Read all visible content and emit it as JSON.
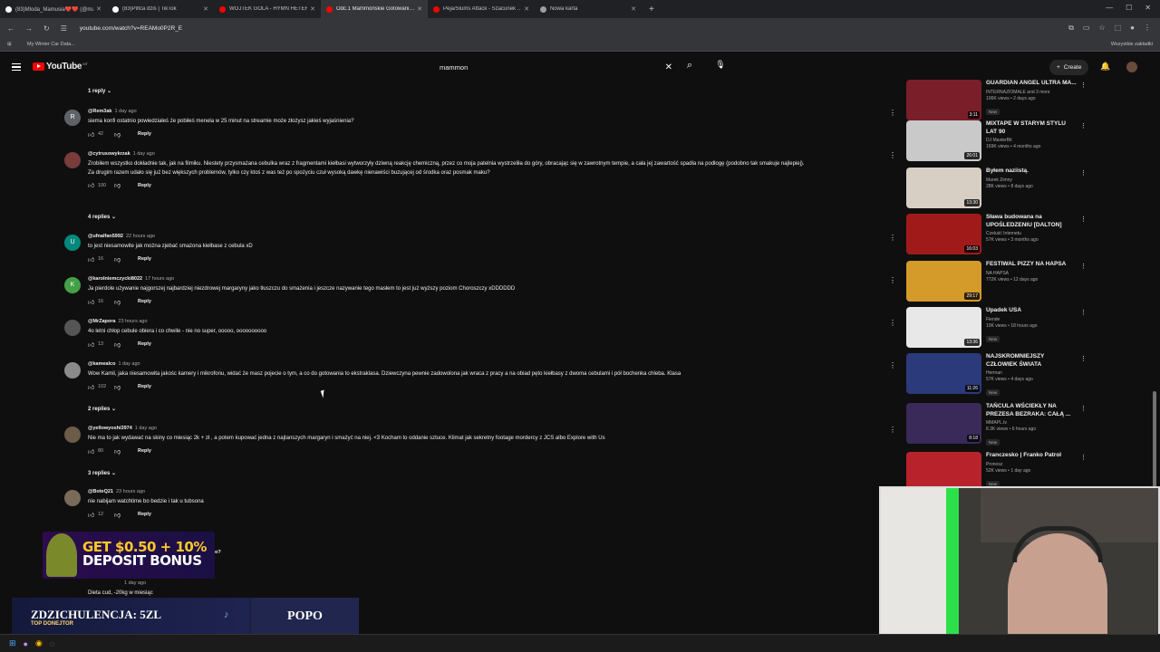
{
  "browser": {
    "tabs": [
      {
        "label": "(83)Mloda_Mamusia❤️❤️ (@ma…",
        "icon": "tiktok-icon",
        "color": "#ffffff"
      },
      {
        "label": "(83)Piltca dziś | TikTok",
        "icon": "tiktok-icon",
        "color": "#ffffff"
      },
      {
        "label": "WOJTEK GOLA - HYMN HETER…",
        "icon": "youtube-icon",
        "color": "#ff0000"
      },
      {
        "label": "Odc.1 Mammońskie Gotowani…",
        "icon": "youtube-icon",
        "color": "#ff0000"
      },
      {
        "label": "Peja/Slums Attack - Szacunek …",
        "icon": "youtube-icon",
        "color": "#ff0000"
      },
      {
        "label": "Nowa karta",
        "icon": "globe-icon",
        "color": "#9aa0a6"
      }
    ],
    "url": "youtube.com/watch?v=REAMo0P2R_E",
    "bookmark": "My Winter Car Data...",
    "bookmarks_all": "Wszystkie zakładki"
  },
  "youtube": {
    "logo": "YouTube",
    "logo_country": "MT",
    "search_value": "mammon",
    "create_label": "Create"
  },
  "comments": [
    {
      "replies_label": "1 reply"
    },
    {
      "author": "@Rem3ak",
      "time": "1 day ago",
      "text": "siema konfi ostatnio powiedziałeś że pobiłeś menela w 25 minut na streamie może złożysz jakieś wyjaśnienia?",
      "likes": "42",
      "reply": "Reply",
      "avatar_letter": "R",
      "avatar_color": "#5f6368"
    },
    {
      "author": "@cytrusowykrzak",
      "time": "1 day ago",
      "text": "Zrobiłem wszystko dokładnie tak, jak na filmiku. Niestety przysmażana cebulka wraz z fragmentami kiełbasi wytworzyły dziwną reakcję chemiczną, przez co moja patelnia wystrzeliła do góry, obracając się w zawrotnym tempie, a cała jej zawartość spadła na podłogę (podobno tak smakuje najlepiej).",
      "text2": "Za drugim razem udało się już bez większych problemów, tylko czy ktoś z was też po spożyciu czuł wysoką dawkę nienawiści buzującej od środka oraz posmak maku?",
      "likes": "100",
      "reply": "Reply",
      "avatar_letter": "",
      "avatar_color": "#7a3b3b"
    },
    {
      "replies_label": "4 replies"
    },
    {
      "author": "@ufnalfan5992",
      "time": "22 hours ago",
      "text": "to jest niesamowite jak można zjebać smażona kiełbase z cebula xD",
      "likes": "16",
      "reply": "Reply",
      "avatar_letter": "U",
      "avatar_color": "#00897b"
    },
    {
      "author": "@karolniemczycki8022",
      "time": "17 hours ago",
      "text": "Ja pierdole używanie najgorszej najbardziej niezdrowej margaryny jako tłuszczu do smażenia i jeszcze nazywanie tego masłem to jest już wyższy poziom Choroszczy xDDDDDD",
      "likes": "16",
      "reply": "Reply",
      "avatar_letter": "K",
      "avatar_color": "#43a047"
    },
    {
      "author": "@MrZapora",
      "time": "23 hours ago",
      "text": "4o letni chłop cebule obiera i co chwile - nie no super, ooooo, oooooooooo",
      "likes": "13",
      "reply": "Reply",
      "avatar_letter": "",
      "avatar_color": "#555555"
    },
    {
      "author": "@kamealco",
      "time": "1 day ago",
      "text": "Wow Kamil, jaka niesamowita jakośc kamery i mikrofonu, widać że masz pojecie o tym, a co do gotowania to ekstraklasa. Dziewczyna pewnie zadowolona jak wraca z pracy a na obiad pęto kiełbasy z dwoma cebulami i pół bochenka chleba. Klasa",
      "likes": "102",
      "reply": "Reply",
      "avatar_letter": "",
      "avatar_color": "#8a8a8a"
    },
    {
      "replies_label": "2 replies"
    },
    {
      "author": "@yellowyoshi3974",
      "time": "1 day ago",
      "text": "Nie ma to jak wydawać na skiny co miesiąc 2k + zł , a potem kupować jedna z najtanszych margaryn i smażyć na niej. <3 Kocham to oddanie sztuce. Klimat jak sekretny footage mordercy z JCS albo Explore with Us",
      "likes": "80",
      "reply": "Reply",
      "avatar_letter": "",
      "avatar_color": "#6d5c4a"
    },
    {
      "replies_label": "3 replies"
    },
    {
      "author": "@BoteQ21",
      "time": "23 hours ago",
      "text": "nie nabijam watchtime bo bedzie i tak u tubsona",
      "likes": "12",
      "reply": "Reply",
      "avatar_letter": "",
      "avatar_color": "#7a6a5a"
    },
    {
      "author_partial": "o?",
      "text": "Dieta cud, -20kg w miesiąc",
      "time": "1 day ago"
    }
  ],
  "sidebar": [
    {
      "title": "GUARDIAN ANGEL ULTRA MA...",
      "channel": "INTERNAZIOMALE",
      "meta": "106K views • 2 days ago",
      "extra": "and 3 more",
      "badge": "New",
      "duration": "3:11",
      "thumb": "#7a1e2a"
    },
    {
      "title": "MIXTAPE W STARYM STYLU LAT 90",
      "channel": "DJ MasterBit",
      "meta": "169K views • 4 months ago",
      "badge": "",
      "duration": "26:01",
      "thumb": "#c9c9c9"
    },
    {
      "title": "Byłem naziistą.",
      "channel": "Marek Zimny",
      "meta": "28K views • 8 days ago",
      "badge": "",
      "duration": "13:30",
      "thumb": "#d8cfc4"
    },
    {
      "title": "Sława budowana na UPOŚLEDZENIU [DALTON]",
      "channel": "Czeluść Internetu",
      "meta": "57K views • 3 months ago",
      "badge": "",
      "duration": "16:03",
      "thumb": "#a11a1a"
    },
    {
      "title": "FESTIWAL PIZZY NA HAPSA",
      "channel": "NA HAPSA",
      "meta": "772K views • 12 days ago",
      "badge": "",
      "duration": "29:17",
      "thumb": "#d49a2a"
    },
    {
      "title": "Upadek USA",
      "channel": "Fiende",
      "meta": "10K views • 18 hours ago",
      "badge": "New",
      "duration": "13:36",
      "thumb": "#e8e8e8"
    },
    {
      "title": "NAJSKROMNIEJSZY CZŁOWIEK ŚWIATA",
      "channel": "Herman",
      "meta": "57K views • 4 days ago",
      "badge": "New",
      "duration": "11:26",
      "thumb": "#2a3a7a"
    },
    {
      "title": "TAŃCULA WŚCIEKŁY NA PREZESA BEZRAKA: CAŁĄ ...",
      "channel": "MMAPL.tv",
      "meta": "8.3K views • 6 hours ago",
      "badge": "New",
      "duration": "8:18",
      "thumb": "#3a2a5a"
    },
    {
      "title": "Franczesko | Franko Patrol",
      "channel": "Pronosz",
      "meta": "52K views • 1 day ago",
      "badge": "New",
      "duration": "",
      "thumb": "#b8222a"
    }
  ],
  "overlay": {
    "ad_line1": "GET $0.50 + 10%",
    "ad_line2": "DEPOSIT BONUS",
    "donor_name": "ZDZICHULENCJA: 5ZL",
    "donor_sub": "TOP DONEJTOR",
    "donor_amount": "POPO"
  }
}
